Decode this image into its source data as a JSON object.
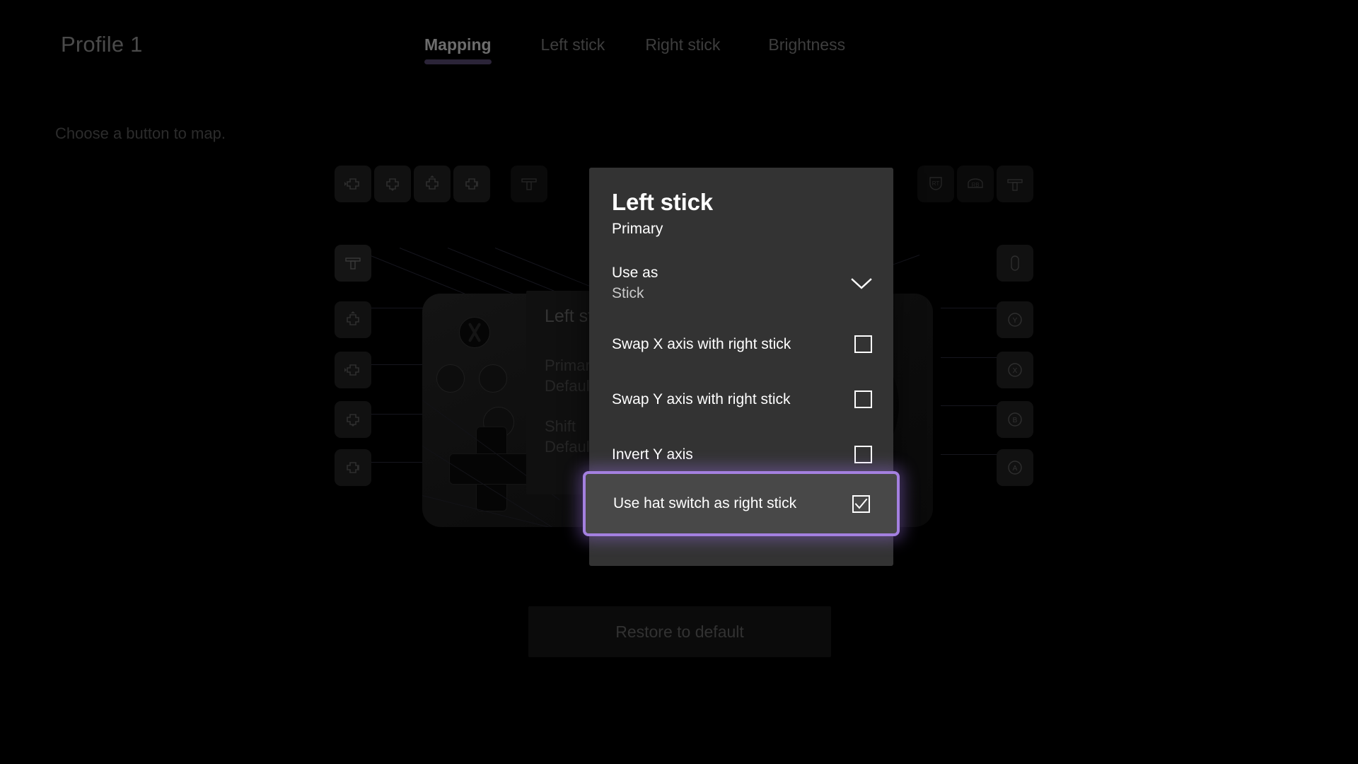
{
  "header": {
    "profile_title": "Profile 1",
    "tabs": [
      {
        "label": "Mapping",
        "active": true
      },
      {
        "label": "Left stick",
        "active": false
      },
      {
        "label": "Right stick",
        "active": false
      },
      {
        "label": "Brightness",
        "active": false
      }
    ],
    "subtitle": "Choose a button to map."
  },
  "background_card": {
    "title": "Left stick",
    "primary_label": "Primary",
    "primary_value": "Default",
    "shift_label": "Shift",
    "shift_value": "Default"
  },
  "restore_button": {
    "label": "Restore to default"
  },
  "dialog": {
    "title": "Left stick",
    "subtitle": "Primary",
    "use_as": {
      "label": "Use as",
      "value": "Stick",
      "icon": "chevron-down-icon"
    },
    "options": [
      {
        "label": "Swap X axis with right stick",
        "checked": false
      },
      {
        "label": "Swap Y axis with right stick",
        "checked": false
      },
      {
        "label": "Invert Y axis",
        "checked": false
      },
      {
        "label": "Use hat switch as right stick",
        "checked": true,
        "highlighted": true
      }
    ]
  },
  "controller_buttons": {
    "top_row": [
      "dpad-left-icon",
      "dpad-down-icon",
      "dpad-up-icon",
      "dpad-right-icon"
    ],
    "top_center": [
      "left-paddle-icon"
    ],
    "top_right": [
      "rt-trigger-icon",
      "rb-bumper-icon",
      "right-paddle-icon"
    ],
    "left_column": [
      "lt-trigger-icon",
      "dpad-up-icon",
      "dpad-left-icon",
      "dpad-down-icon",
      "dpad-right-icon"
    ],
    "right_column": [
      "right-stick-icon",
      "y-button-icon",
      "x-button-icon",
      "b-button-icon",
      "a-button-icon"
    ],
    "right_labels": [
      "Y",
      "X",
      "B",
      "A"
    ]
  },
  "colors": {
    "accent_purple": "#a480e0",
    "dialog_bg": "#333333",
    "highlight_row_bg": "#484848",
    "page_bg": "#000000",
    "tab_underline": "#2b2438"
  }
}
